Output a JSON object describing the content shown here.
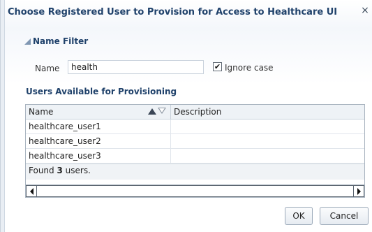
{
  "dialog": {
    "title": "Choose Registered User to Provision for Access to Healthcare UI",
    "close_glyph": "×"
  },
  "filter": {
    "section_title": "Name Filter",
    "name_label": "Name",
    "name_value": "health",
    "ignore_case_label": "Ignore case",
    "ignore_case_checked": true,
    "check_glyph": "✔"
  },
  "users": {
    "section_title": "Users Available for Provisioning",
    "columns": [
      "Name",
      "Description"
    ],
    "rows": [
      {
        "name": "healthcare_user1",
        "description": ""
      },
      {
        "name": "healthcare_user2",
        "description": ""
      },
      {
        "name": "healthcare_user3",
        "description": ""
      }
    ],
    "found_prefix": "Found",
    "found_count": "3",
    "found_suffix": "users."
  },
  "buttons": {
    "ok": "OK",
    "cancel": "Cancel"
  },
  "colors": {
    "title": "#20426b",
    "border": "#a9b4c0"
  }
}
